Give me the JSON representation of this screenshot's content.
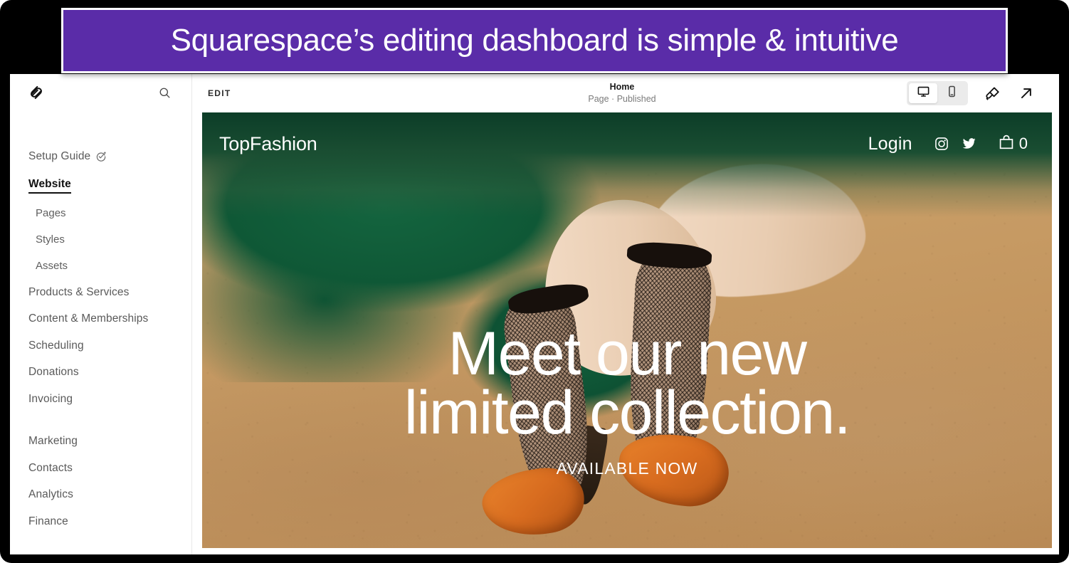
{
  "caption": {
    "text": "Squarespace’s editing dashboard is simple & intuitive",
    "background_color": "#5A2CA8",
    "text_color": "#FFFFFF"
  },
  "sidebar": {
    "logo_icon": "squarespace-logo-icon",
    "search_icon": "search-icon",
    "items": [
      {
        "label": "Setup Guide",
        "icon": "setup-guide-check-sparkle-icon",
        "type": "link",
        "active": false
      },
      {
        "label": "Website",
        "type": "section",
        "active": true
      },
      {
        "label": "Pages",
        "type": "sub",
        "active": false
      },
      {
        "label": "Styles",
        "type": "sub",
        "active": false
      },
      {
        "label": "Assets",
        "type": "sub",
        "active": false
      },
      {
        "label": "Products & Services",
        "type": "section",
        "active": false
      },
      {
        "label": "Content & Memberships",
        "type": "section",
        "active": false
      },
      {
        "label": "Scheduling",
        "type": "section",
        "active": false
      },
      {
        "label": "Donations",
        "type": "section",
        "active": false
      },
      {
        "label": "Invoicing",
        "type": "section",
        "active": false
      },
      {
        "label": "Marketing",
        "type": "section",
        "active": false
      },
      {
        "label": "Contacts",
        "type": "section",
        "active": false
      },
      {
        "label": "Analytics",
        "type": "section",
        "active": false
      },
      {
        "label": "Finance",
        "type": "section",
        "active": false
      }
    ]
  },
  "toolbar": {
    "edit_label": "EDIT",
    "page_title": "Home",
    "page_status": "Page · Published",
    "view_desktop": {
      "icon": "desktop-monitor-icon",
      "active": true
    },
    "view_mobile": {
      "icon": "mobile-phone-icon",
      "active": false
    },
    "style_icon": "paintbrush-icon",
    "open_site_icon": "external-link-arrow-icon"
  },
  "site_preview": {
    "logo": "TopFashion",
    "nav": {
      "login": "Login",
      "instagram_icon": "instagram-icon",
      "twitter_icon": "twitter-bird-icon",
      "cart_icon": "shopping-bag-icon",
      "cart_count": "0"
    },
    "hero": {
      "heading_line1": "Meet our new",
      "heading_line2": "limited collection.",
      "subheading": "AVAILABLE NOW",
      "text_color": "#FFFFFF"
    }
  }
}
